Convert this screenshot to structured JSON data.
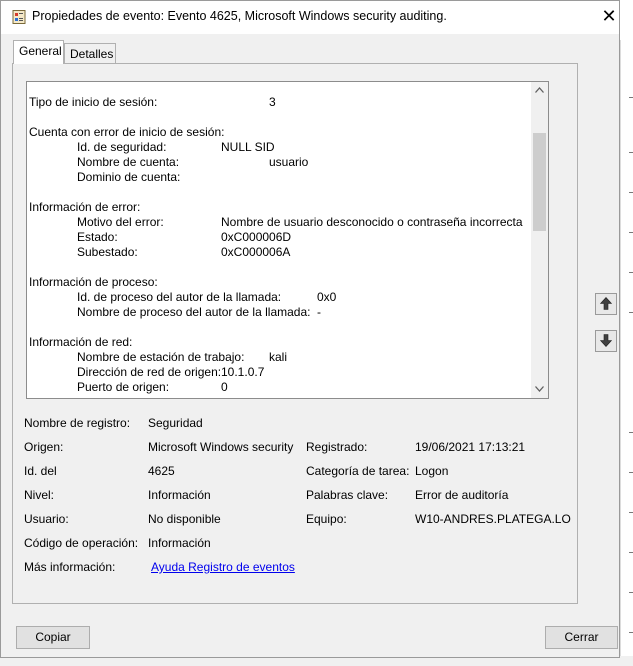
{
  "window": {
    "title": "Propiedades de evento: Evento 4625, Microsoft Windows security auditing.",
    "close_glyph": "✕"
  },
  "tabs": [
    {
      "label": "General",
      "active": true
    },
    {
      "label": "Detalles",
      "active": false
    }
  ],
  "description": {
    "lines": [
      {
        "label": "Tipo de inicio de sesión:",
        "value": "3"
      },
      {
        "heading": "Cuenta con error de inicio de sesión:"
      },
      {
        "label": "Id. de seguridad:",
        "value": "NULL SID"
      },
      {
        "label": "Nombre de cuenta:",
        "value": "usuario"
      },
      {
        "label": "Dominio de cuenta:",
        "value": ""
      },
      {
        "heading": "Información de error:"
      },
      {
        "label": "Motivo del error:",
        "value": "Nombre de usuario desconocido o contraseña incorrecta"
      },
      {
        "label": "Estado:",
        "value": "0xC000006D"
      },
      {
        "label": "Subestado:",
        "value": "0xC000006A"
      },
      {
        "heading": "Información de proceso:"
      },
      {
        "label": "Id. de proceso del autor de la llamada:",
        "value": "0x0"
      },
      {
        "label": "Nombre de proceso del autor de la llamada:",
        "value": "-"
      },
      {
        "heading": "Información de red:"
      },
      {
        "label": "Nombre de estación de trabajo:",
        "value": "kali"
      },
      {
        "label": "Dirección de red de origen:",
        "value": "10.1.0.7"
      },
      {
        "label": "Puerto de origen:",
        "value": "0"
      }
    ]
  },
  "properties": {
    "log_name": {
      "label": "Nombre de registro:",
      "value": "Seguridad"
    },
    "source": {
      "label": "Origen:",
      "value": "Microsoft Windows security"
    },
    "logged": {
      "label": "Registrado:",
      "value": "19/06/2021 17:13:21"
    },
    "event_id": {
      "label": "Id. del",
      "value": "4625"
    },
    "task_category": {
      "label": "Categoría de tarea:",
      "value": "Logon"
    },
    "level": {
      "label": "Nivel:",
      "value": "Información"
    },
    "keywords": {
      "label": "Palabras clave:",
      "value": "Error de auditoría"
    },
    "user": {
      "label": "Usuario:",
      "value": "No disponible"
    },
    "computer": {
      "label": "Equipo:",
      "value": "W10-ANDRES.PLATEGA.LO"
    },
    "opcode": {
      "label": "Código de operación:",
      "value": "Información"
    },
    "more_info": {
      "label": "Más información:",
      "link": "Ayuda Registro de eventos"
    }
  },
  "buttons": {
    "copy": "Copiar",
    "close": "Cerrar"
  },
  "icons": {
    "app": "event-viewer-icon",
    "prev": "arrow-up-icon",
    "next": "arrow-down-icon",
    "scroll_up": "chevron-up-icon",
    "scroll_down": "chevron-down-icon"
  }
}
